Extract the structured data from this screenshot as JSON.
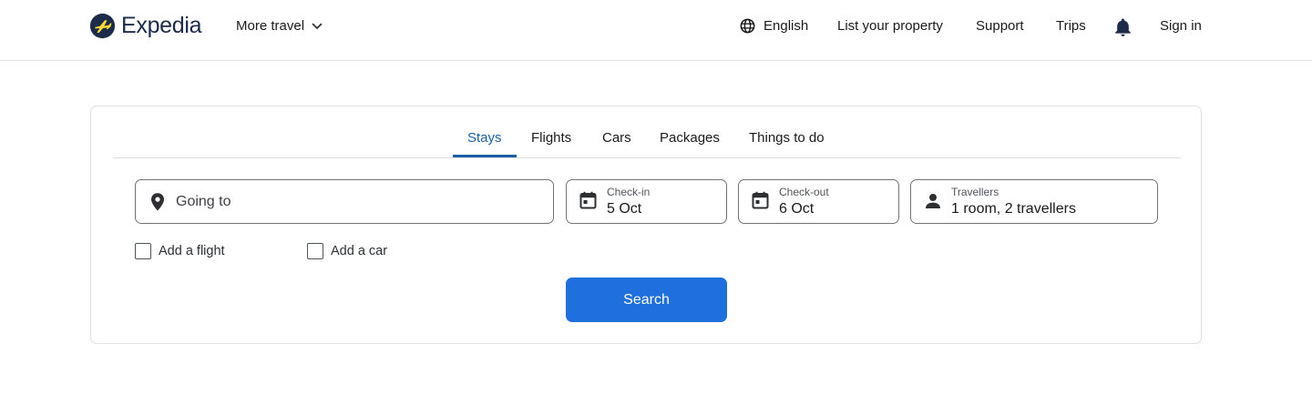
{
  "header": {
    "brand": "Expedia",
    "more_travel": "More travel",
    "language": "English",
    "list_property": "List your property",
    "support": "Support",
    "trips": "Trips",
    "sign_in": "Sign in"
  },
  "search_card": {
    "tabs": [
      {
        "label": "Stays",
        "active": true
      },
      {
        "label": "Flights",
        "active": false
      },
      {
        "label": "Cars",
        "active": false
      },
      {
        "label": "Packages",
        "active": false
      },
      {
        "label": "Things to do",
        "active": false
      }
    ],
    "going_to": {
      "placeholder": "Going to"
    },
    "check_in": {
      "label": "Check-in",
      "value": "5 Oct"
    },
    "check_out": {
      "label": "Check-out",
      "value": "6 Oct"
    },
    "travellers": {
      "label": "Travellers",
      "value": "1 room, 2 travellers"
    },
    "add_flight": {
      "label": "Add a flight",
      "checked": false
    },
    "add_car": {
      "label": "Add a car",
      "checked": false
    },
    "search_button": "Search"
  },
  "colors": {
    "accent": "#1f6fde",
    "active_tab": "#1a5fa8",
    "brand_navy": "#1c2b4a",
    "brand_yellow": "#fddb32"
  },
  "icons": {
    "logo": "plane-logo-icon",
    "more_travel": "chevron-down-icon",
    "language": "globe-icon",
    "notifications": "bell-icon",
    "going_to": "map-pin-icon",
    "check_in": "calendar-icon",
    "check_out": "calendar-icon",
    "travellers": "person-icon"
  }
}
